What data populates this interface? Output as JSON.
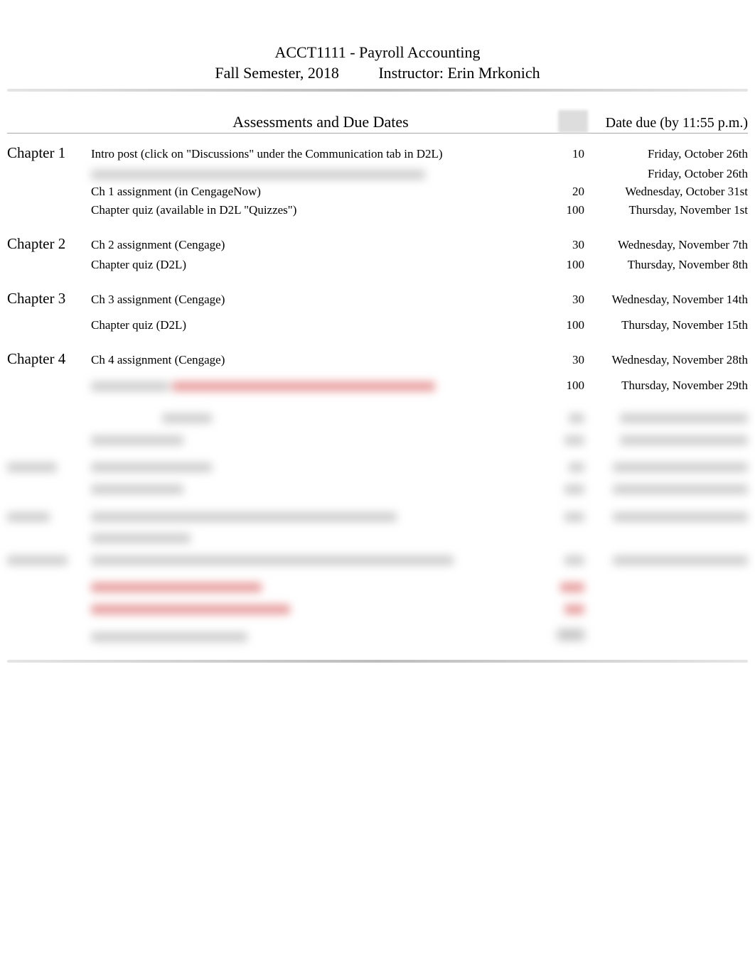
{
  "header": {
    "course": "ACCT1111 - Payroll Accounting",
    "semester": "Fall Semester, 2018",
    "instructor": "Instructor: Erin Mrkonich"
  },
  "columns": {
    "assessments": "Assessments and Due Dates",
    "date": "Date due (by 11:55 p.m.)"
  },
  "sections": [
    {
      "chapter": "Chapter 1",
      "items": [
        {
          "desc": "Intro post (click on \"Discussions\" under the Communication tab in D2L)",
          "pts": "10",
          "date": "Friday, October 26th"
        },
        {
          "desc": "",
          "desc_note": "",
          "pts": "",
          "date": "Friday, October 26th",
          "blurred_desc": true
        },
        {
          "desc": "Ch 1 assignment (in CengageNow)",
          "pts": "20",
          "date": "Wednesday, October 31st"
        },
        {
          "desc": "Chapter quiz (available in D2L \"Quizzes\")",
          "pts": "100",
          "date": "Thursday, November 1st"
        }
      ]
    },
    {
      "chapter": "Chapter 2",
      "items": [
        {
          "desc": "Ch 2 assignment (Cengage)",
          "pts": "30",
          "date": "Wednesday, November 7th"
        },
        {
          "desc": "Chapter quiz (D2L)",
          "pts": "100",
          "date": "Thursday, November 8th"
        }
      ]
    },
    {
      "chapter": "Chapter 3",
      "items": [
        {
          "desc": "Ch 3 assignment  (Cengage)",
          "pts": "30",
          "date": "Wednesday, November 14th"
        },
        {
          "desc": "Chapter quiz  (D2L)",
          "pts": "100",
          "date": "Thursday, November 15th"
        }
      ]
    },
    {
      "chapter": "Chapter 4",
      "items": [
        {
          "desc": "Ch 4 assignment (Cengage)",
          "pts": "30",
          "date": "Wednesday, November 28th"
        },
        {
          "desc": "Chapter quiz (D2L)",
          "desc_red": "",
          "pts": "100",
          "date": "Thursday, November 29th",
          "blurred_suffix": true
        }
      ]
    }
  ]
}
